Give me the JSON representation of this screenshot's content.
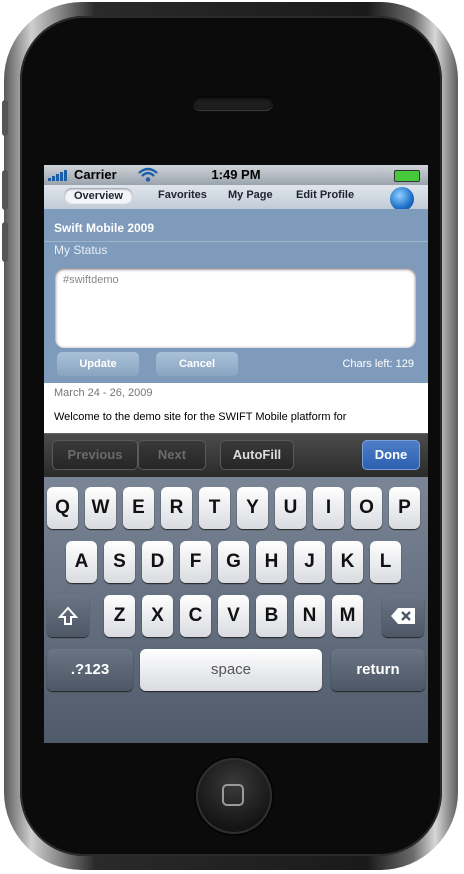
{
  "status_bar": {
    "carrier": "Carrier",
    "time": "1:49 PM"
  },
  "tabs": [
    "Overview",
    "Favorites",
    "My Page",
    "Edit Profile"
  ],
  "page": {
    "site_title": "Swift Mobile 2009",
    "status_heading": "My Status",
    "status_input_value": "#swiftdemo",
    "update_label": "Update",
    "cancel_label": "Cancel",
    "chars_left": "Chars left: 129",
    "dates": "March 24 - 26, 2009",
    "welcome_text": "Welcome to the demo site for the SWIFT Mobile platform for"
  },
  "form_accessory": {
    "previous": "Previous",
    "next": "Next",
    "autofill": "AutoFill",
    "done": "Done"
  },
  "keyboard": {
    "row1": [
      "Q",
      "W",
      "E",
      "R",
      "T",
      "Y",
      "U",
      "I",
      "O",
      "P"
    ],
    "row2": [
      "A",
      "S",
      "D",
      "F",
      "G",
      "H",
      "J",
      "K",
      "L"
    ],
    "row3": [
      "Z",
      "X",
      "C",
      "V",
      "B",
      "N",
      "M"
    ],
    "numbers_label": ".?123",
    "space_label": "space",
    "return_label": "return",
    "shift_icon": "shift-icon",
    "backspace_icon": "backspace-icon"
  }
}
